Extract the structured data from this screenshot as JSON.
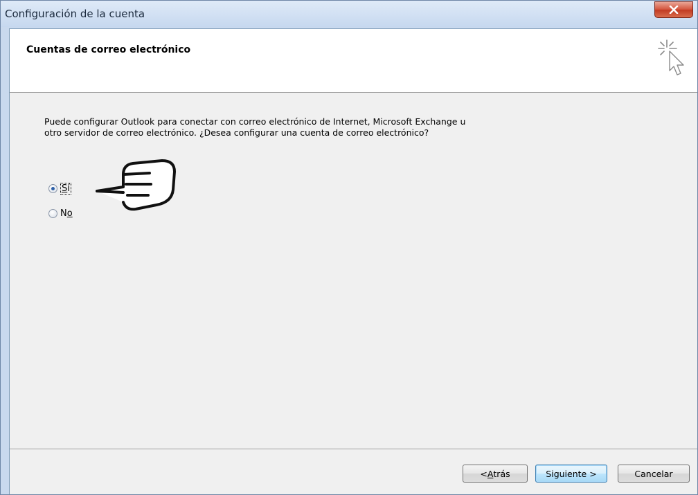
{
  "window": {
    "title": "Configuración de la cuenta",
    "close_glyph": "✕"
  },
  "header": {
    "title": "Cuentas de correo electrónico",
    "icon": "wizard-cursor-sparkle-icon"
  },
  "body": {
    "description": "Puede configurar Outlook para conectar con correo electrónico de Internet, Microsoft Exchange u otro servidor de correo electrónico. ¿Desea configurar una cuenta de correo electrónico?",
    "options": [
      {
        "label_accel": "S",
        "label_rest": "í",
        "checked": true
      },
      {
        "label_pre": "N",
        "label_accel": "o",
        "checked": false
      }
    ],
    "pointer_icon": "hand-pointer-icon"
  },
  "footer": {
    "back_accel": "A",
    "back_pre": "< ",
    "back_rest": "trás",
    "next_label": "Siguiente >",
    "cancel_label": "Cancelar"
  },
  "colors": {
    "title_bar": "#c6d8ef",
    "close_button": "#c13a22",
    "primary_button_border": "#3c7fb1"
  }
}
